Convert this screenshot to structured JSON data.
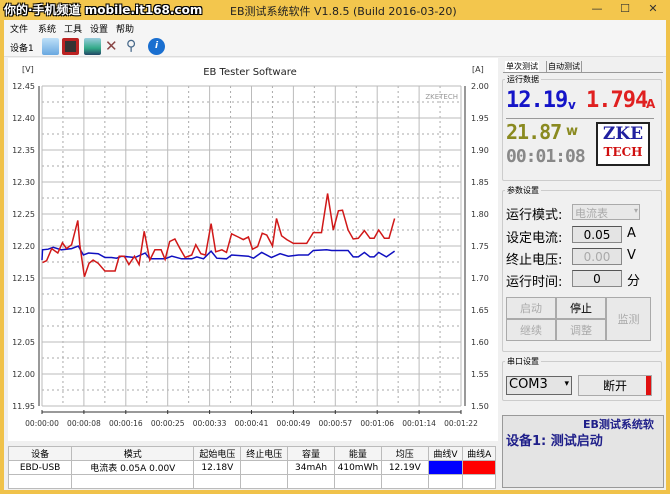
{
  "window": {
    "title": "EB测试系统软件 V1.8.5 (Build 2016-03-20)",
    "watermark": "你的·手机频道 mobile.it168.com",
    "minimize": "—",
    "maximize": "☐",
    "close": "✕"
  },
  "menu": [
    "文件",
    "系统",
    "工具",
    "设置",
    "帮助"
  ],
  "toolbar": {
    "device_label": "设备1",
    "icons": [
      "open-folder-icon",
      "save-icon",
      "chart-image-icon",
      "tools-icon",
      "search-icon",
      "info-icon"
    ]
  },
  "chart_data": {
    "type": "line",
    "title": "EB Tester Software",
    "watermark": "ZKETECH",
    "ylabel_left": "[V]",
    "ylabel_right": "[A]",
    "ylim_left": [
      11.95,
      12.45
    ],
    "ylim_right": [
      1.5,
      2.0
    ],
    "xlim": [
      0,
      82
    ],
    "yticks_left": [
      "12.45",
      "12.40",
      "12.35",
      "12.30",
      "12.25",
      "12.20",
      "12.15",
      "12.10",
      "12.05",
      "12.00",
      "11.95"
    ],
    "yticks_right": [
      "2.00",
      "1.95",
      "1.90",
      "1.85",
      "1.80",
      "1.75",
      "1.70",
      "1.65",
      "1.60",
      "1.55",
      "1.50"
    ],
    "xticks": [
      "00:00:00",
      "00:00:08",
      "00:00:16",
      "00:00:25",
      "00:00:33",
      "00:00:41",
      "00:00:49",
      "00:00:57",
      "00:01:06",
      "00:01:14",
      "00:01:22"
    ],
    "grid": true,
    "series": [
      {
        "name": "Voltage",
        "axis": "left",
        "color": "#1010c0",
        "x": [
          0,
          0.1,
          1.2,
          2.2,
          3.8,
          5.8,
          7.1,
          8.1,
          9.1,
          11.0,
          12.3,
          13.6,
          14.6,
          15.6,
          18.2,
          20.2,
          21.1,
          24.1,
          25.4,
          27.3,
          29.3,
          30.3,
          31.6,
          33.1,
          34.2,
          36.1,
          37.1,
          40.4,
          41.4,
          43.0,
          44.9,
          46.6,
          48.2,
          50.2,
          52.1,
          53.1,
          55.7,
          56.7,
          59.9,
          60.9,
          61.9,
          63.1,
          64.2,
          65.0,
          65.9,
          67.4,
          69.0
        ],
        "y": [
          12.178,
          12.194,
          12.195,
          12.198,
          12.194,
          12.196,
          12.2,
          12.186,
          12.189,
          12.188,
          12.182,
          12.182,
          12.181,
          12.184,
          12.182,
          12.189,
          12.18,
          12.18,
          12.184,
          12.18,
          12.18,
          12.183,
          12.18,
          12.192,
          12.181,
          12.18,
          12.186,
          12.184,
          12.181,
          12.19,
          12.182,
          12.188,
          12.184,
          12.186,
          12.186,
          12.193,
          12.194,
          12.193,
          12.193,
          12.183,
          12.183,
          12.19,
          12.183,
          12.183,
          12.19,
          12.183,
          12.192
        ]
      },
      {
        "name": "Current",
        "axis": "right",
        "color": "#d01818",
        "x": [
          0.1,
          0.9,
          1.9,
          3.1,
          4.0,
          4.8,
          5.8,
          7.0,
          7.4,
          8.3,
          9.2,
          10.0,
          11.0,
          12.3,
          14.3,
          15.1,
          16.1,
          17.0,
          18.1,
          19.0,
          20.0,
          21.1,
          22.1,
          23.3,
          24.1,
          25.0,
          26.0,
          27.0,
          28.0,
          29.3,
          30.1,
          31.1,
          32.0,
          33.1,
          34.0,
          35.2,
          36.1,
          37.1,
          38.4,
          39.4,
          40.4,
          41.2,
          42.2,
          43.1,
          44.0,
          45.1,
          45.9,
          46.9,
          47.9,
          49.2,
          51.8,
          53.1,
          54.7,
          55.9,
          57.0,
          58.0,
          58.8,
          59.9,
          60.9,
          61.9,
          63.1,
          64.2,
          65.0,
          65.9,
          67.0,
          67.9,
          69.0
        ],
        "y": [
          1.724,
          1.727,
          1.746,
          1.739,
          1.755,
          1.746,
          1.752,
          1.79,
          1.752,
          1.702,
          1.723,
          1.728,
          1.723,
          1.711,
          1.711,
          1.734,
          1.734,
          1.721,
          1.734,
          1.721,
          1.773,
          1.728,
          1.744,
          1.744,
          1.729,
          1.757,
          1.761,
          1.746,
          1.732,
          1.736,
          1.752,
          1.738,
          1.736,
          1.785,
          1.741,
          1.744,
          1.74,
          1.769,
          1.764,
          1.76,
          1.764,
          1.745,
          1.749,
          1.77,
          1.767,
          1.75,
          1.793,
          1.766,
          1.76,
          1.754,
          1.754,
          1.771,
          1.771,
          1.832,
          1.775,
          1.805,
          1.806,
          1.775,
          1.761,
          1.762,
          1.774,
          1.762,
          1.762,
          1.775,
          1.762,
          1.762,
          1.793
        ]
      }
    ]
  },
  "table": {
    "headers": [
      "设备",
      "模式",
      "起始电压",
      "终止电压",
      "容量",
      "能量",
      "均压",
      "曲线V",
      "曲线A"
    ],
    "rows": [
      [
        "EBD-USB",
        "电流表  0.05A  0.00V",
        "12.18V",
        "",
        "34mAh",
        "410mWh",
        "12.19V",
        "",
        ""
      ]
    ],
    "curve_colors": [
      "#0000ff",
      "#ff0000"
    ]
  },
  "panel": {
    "tabs": [
      "单次测试",
      "自动测试"
    ],
    "run_group": "运行数据",
    "voltage": "12.19",
    "voltage_unit": "v",
    "current": "1.794",
    "current_unit": "A",
    "power": "21.87",
    "power_unit": "w",
    "time": "00:01:08",
    "logo_top": "ZKE",
    "logo_bottom": "TECH",
    "param_group": "参数设置",
    "mode_label": "运行模式:",
    "mode_value": "电流表",
    "set_current_label": "设定电流:",
    "set_current_value": "0.05",
    "set_current_unit": "A",
    "stop_voltage_label": "终止电压:",
    "stop_voltage_value": "0.00",
    "stop_voltage_unit": "V",
    "run_time_label": "运行时间:",
    "run_time_value": "0",
    "run_time_unit": "分",
    "btn_start": "启动",
    "btn_stop": "停止",
    "btn_monitor": "监测",
    "btn_continue": "继续",
    "btn_adjust": "调整",
    "serial_group": "串口设置",
    "port": "COM3",
    "btn_disconnect": "断开",
    "msg_title": "EB测试系统软",
    "msg_text": "设备1: 测试启动"
  }
}
